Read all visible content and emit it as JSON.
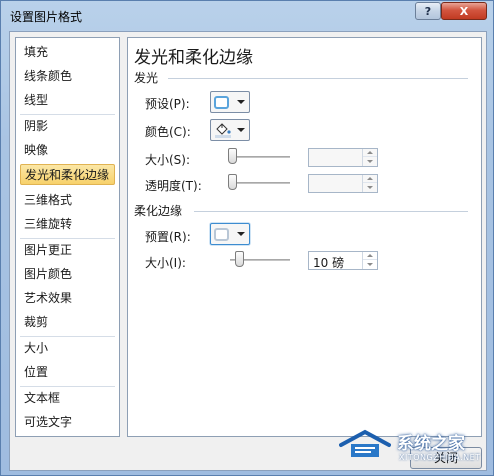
{
  "window": {
    "title": "设置图片格式",
    "help_glyph": "?",
    "close_glyph": "X"
  },
  "nav": {
    "items": [
      {
        "label": "填充",
        "selected": false
      },
      {
        "label": "线条颜色",
        "selected": false
      },
      {
        "label": "线型",
        "selected": false
      },
      {
        "label": "阴影",
        "selected": false
      },
      {
        "label": "映像",
        "selected": false
      },
      {
        "label": "发光和柔化边缘",
        "selected": true
      },
      {
        "label": "三维格式",
        "selected": false
      },
      {
        "label": "三维旋转",
        "selected": false
      },
      {
        "label": "图片更正",
        "selected": false
      },
      {
        "label": "图片颜色",
        "selected": false
      },
      {
        "label": "艺术效果",
        "selected": false
      },
      {
        "label": "裁剪",
        "selected": false
      },
      {
        "label": "大小",
        "selected": false
      },
      {
        "label": "位置",
        "selected": false
      },
      {
        "label": "文本框",
        "selected": false
      },
      {
        "label": "可选文字",
        "selected": false
      }
    ]
  },
  "panel": {
    "title": "发光和柔化边缘",
    "glow": {
      "heading": "发光",
      "preset_label": "预设(P):",
      "color_label": "颜色(C):",
      "size_label": "大小(S):",
      "size_value": "",
      "transparency_label": "透明度(T):",
      "transparency_value": ""
    },
    "soft_edges": {
      "heading": "柔化边缘",
      "preset_label": "预置(R):",
      "size_label": "大小(I):",
      "size_value": "10 磅"
    }
  },
  "footer": {
    "close_label": "关闭"
  },
  "watermark": {
    "name": "系统之家",
    "url": "XITONGZHIJIA.NET"
  },
  "colors": {
    "accent": "#5aa4dc",
    "selected_bg": "#f7d16b",
    "title_bar": "#b9d1ea",
    "close_red": "#c13a22"
  }
}
